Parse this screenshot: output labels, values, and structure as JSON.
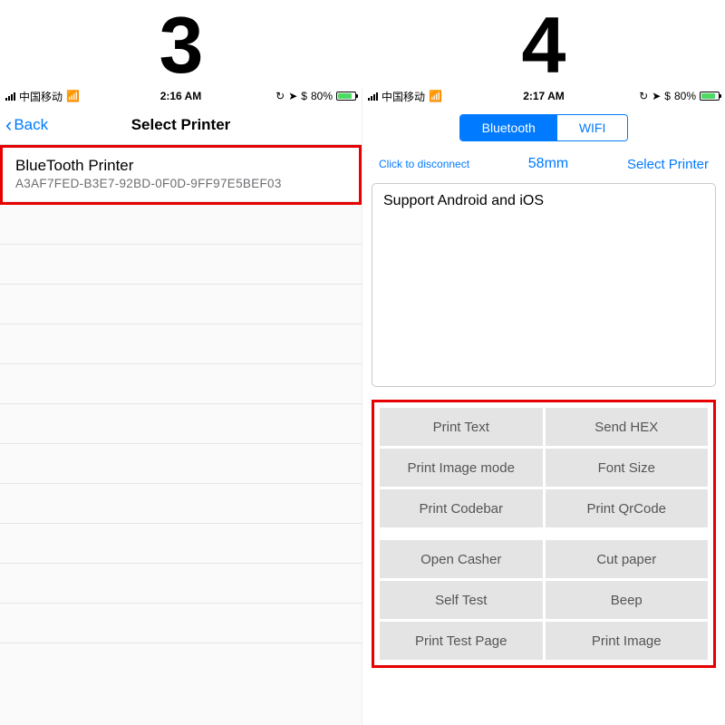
{
  "step_labels": {
    "left": "3",
    "right": "4"
  },
  "status": {
    "carrier": "中国移动",
    "time_left": "2:16 AM",
    "time_right": "2:17 AM",
    "battery_pct": "80%"
  },
  "left": {
    "nav_back": "Back",
    "nav_title": "Select Printer",
    "printer": {
      "name": "BlueTooth Printer",
      "uuid": "A3AF7FED-B3E7-92BD-0F0D-9FF97E5BEF03"
    }
  },
  "right": {
    "segmented": {
      "bluetooth": "Bluetooth",
      "wifi": "WIFI"
    },
    "links": {
      "disconnect": "Click to disconnect",
      "size": "58mm",
      "select_printer": "Select Printer"
    },
    "textpane_content": "Support Android and iOS",
    "buttons": {
      "g1r1a": "Print Text",
      "g1r1b": "Send HEX",
      "g1r2a": "Print Image mode",
      "g1r2b": "Font Size",
      "g1r3a": "Print Codebar",
      "g1r3b": "Print QrCode",
      "g2r1a": "Open Casher",
      "g2r1b": "Cut paper",
      "g2r2a": "Self Test",
      "g2r2b": "Beep",
      "g2r3a": "Print Test Page",
      "g2r3b": "Print Image"
    }
  }
}
